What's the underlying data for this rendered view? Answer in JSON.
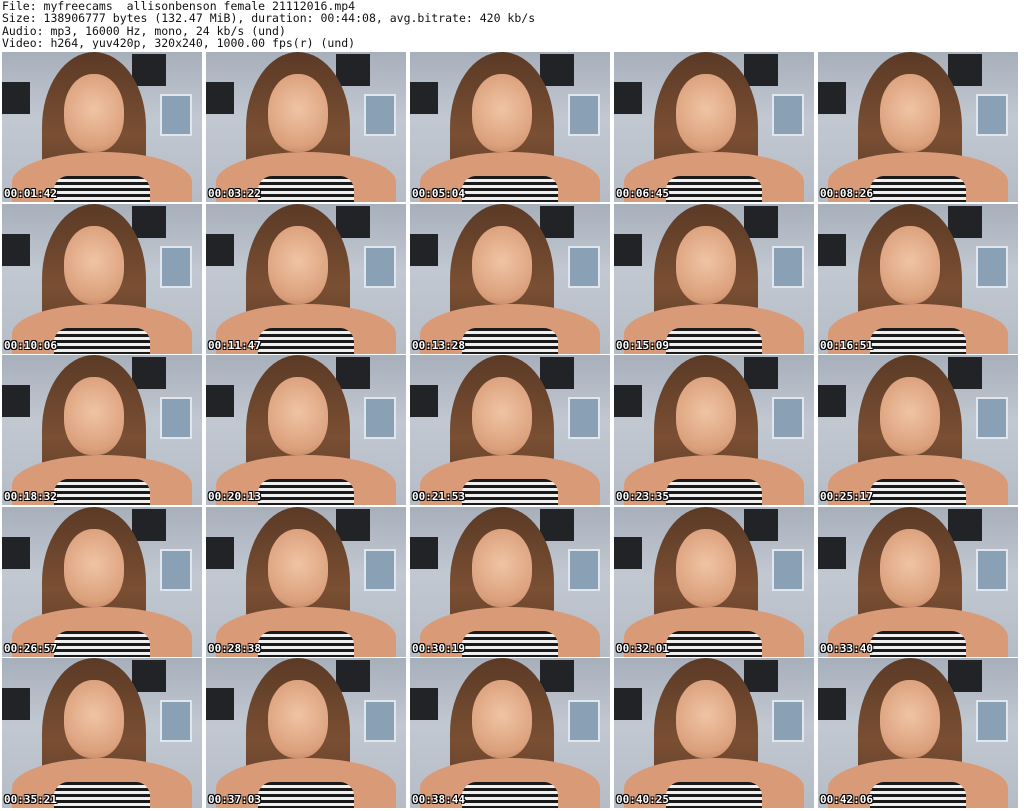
{
  "header": {
    "line1": "File: myfreecams__allisonbenson_female_21112016.mp4",
    "line2": "Size: 138906777 bytes (132.47 MiB), duration: 00:44:08, avg.bitrate: 420 kb/s",
    "line3": "Audio: mp3, 16000 Hz, mono, 24 kb/s (und)",
    "line4": "Video: h264, yuv420p, 320x240, 1000.00 fps(r) (und)"
  },
  "thumbnails": [
    {
      "time": "00:01:42"
    },
    {
      "time": "00:03:22"
    },
    {
      "time": "00:05:04"
    },
    {
      "time": "00:06:45"
    },
    {
      "time": "00:08:26"
    },
    {
      "time": "00:10:06"
    },
    {
      "time": "00:11:47"
    },
    {
      "time": "00:13:28"
    },
    {
      "time": "00:15:09"
    },
    {
      "time": "00:16:51"
    },
    {
      "time": "00:18:32"
    },
    {
      "time": "00:20:13"
    },
    {
      "time": "00:21:53"
    },
    {
      "time": "00:23:35"
    },
    {
      "time": "00:25:17"
    },
    {
      "time": "00:26:57"
    },
    {
      "time": "00:28:38"
    },
    {
      "time": "00:30:19"
    },
    {
      "time": "00:32:01"
    },
    {
      "time": "00:33:40"
    },
    {
      "time": "00:35:21"
    },
    {
      "time": "00:37:03"
    },
    {
      "time": "00:38:44"
    },
    {
      "time": "00:40:25"
    },
    {
      "time": "00:42:06"
    }
  ]
}
